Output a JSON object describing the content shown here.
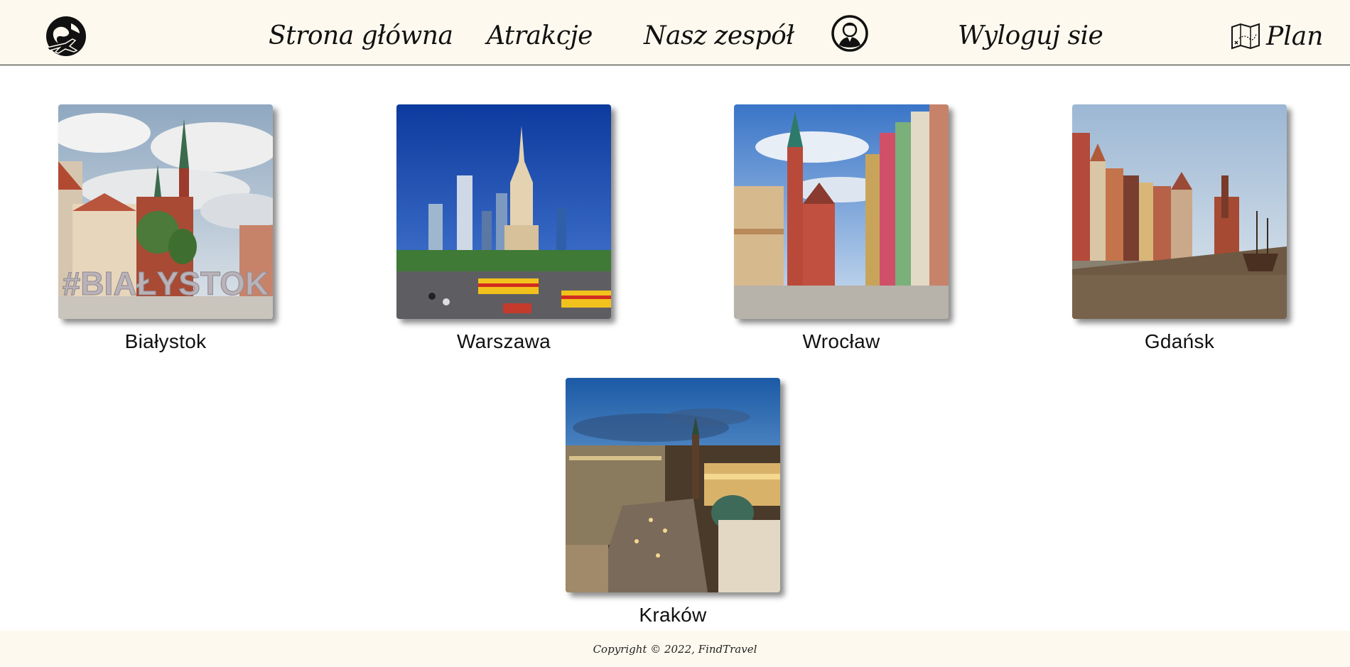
{
  "header": {
    "logo_icon": "globe-plane-icon",
    "nav": {
      "home": "Strona główna",
      "attractions": "Atrakcje",
      "team": "Nasz zespół",
      "logout": "Wyloguj sie"
    },
    "account_icon": "user-account-icon",
    "plan": {
      "icon": "treasure-map-icon",
      "label": "Plan"
    }
  },
  "cities": [
    {
      "name": "Białystok",
      "photo_sign": "#BIAŁYSTOK"
    },
    {
      "name": "Warszawa"
    },
    {
      "name": "Wrocław"
    },
    {
      "name": "Gdańsk"
    },
    {
      "name": "Kraków"
    }
  ],
  "footer": {
    "copyright": "Copyright © 2022, FindTravel"
  },
  "colors": {
    "header_bg": "#fdf9ee",
    "text": "#111111",
    "page_bg": "#ffffff"
  }
}
